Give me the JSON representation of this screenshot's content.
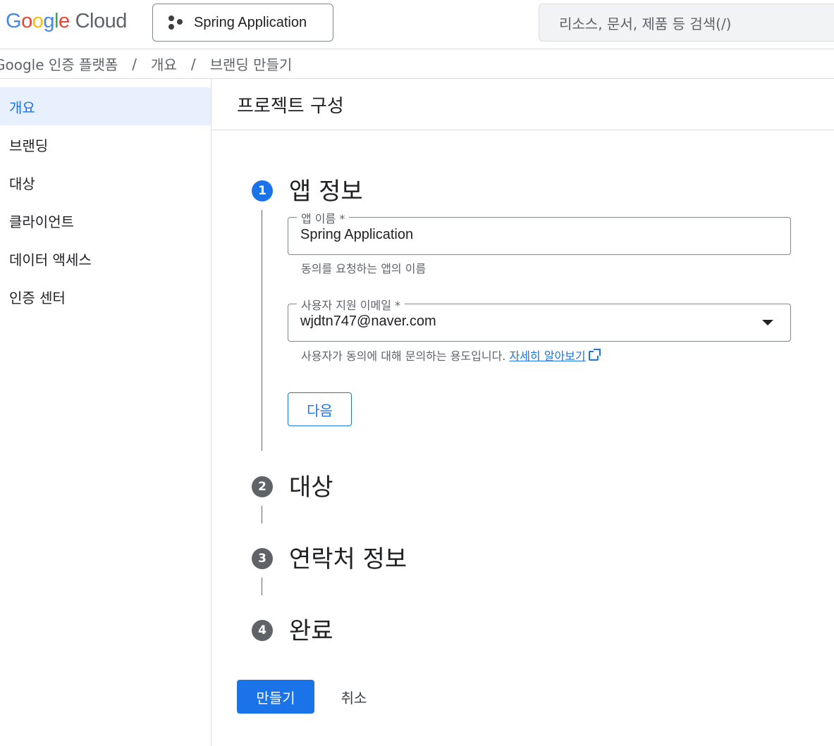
{
  "header": {
    "logo_letters": [
      "G",
      "o",
      "o",
      "g",
      "l",
      "e"
    ],
    "logo_cloud": "Cloud",
    "project_name": "Spring Application",
    "search_placeholder": "리소스, 문서, 제품 등 검색(/)"
  },
  "breadcrumb": [
    "Google 인증 플랫폼",
    "개요",
    "브랜딩 만들기"
  ],
  "breadcrumb_separator": "/",
  "sidebar": {
    "items": [
      {
        "label": "개요",
        "active": true
      },
      {
        "label": "브랜딩",
        "active": false
      },
      {
        "label": "대상",
        "active": false
      },
      {
        "label": "클라이언트",
        "active": false
      },
      {
        "label": "데이터 액세스",
        "active": false
      },
      {
        "label": "인증 센터",
        "active": false
      }
    ]
  },
  "main": {
    "title": "프로젝트 구성",
    "steps": [
      {
        "number": "1",
        "title": "앱 정보",
        "state": "active"
      },
      {
        "number": "2",
        "title": "대상",
        "state": "inactive"
      },
      {
        "number": "3",
        "title": "연락처 정보",
        "state": "inactive"
      },
      {
        "number": "4",
        "title": "완료",
        "state": "inactive"
      }
    ],
    "app_name_field": {
      "label": "앱 이름 *",
      "value": "Spring Application",
      "hint": "동의를 요청하는 앱의 이름"
    },
    "support_email_field": {
      "label": "사용자 지원 이메일 *",
      "value": "wjdtn747@naver.com",
      "hint": "사용자가 동의에 대해 문의하는 용도입니다.",
      "link": "자세히 알아보기"
    },
    "next_button": "다음",
    "create_button": "만들기",
    "cancel_button": "취소"
  },
  "colors": {
    "accent": "#1a73e8",
    "active_nav_bg": "#e8f0fe",
    "inactive_step": "#5f6368",
    "border": "#dadce0"
  }
}
